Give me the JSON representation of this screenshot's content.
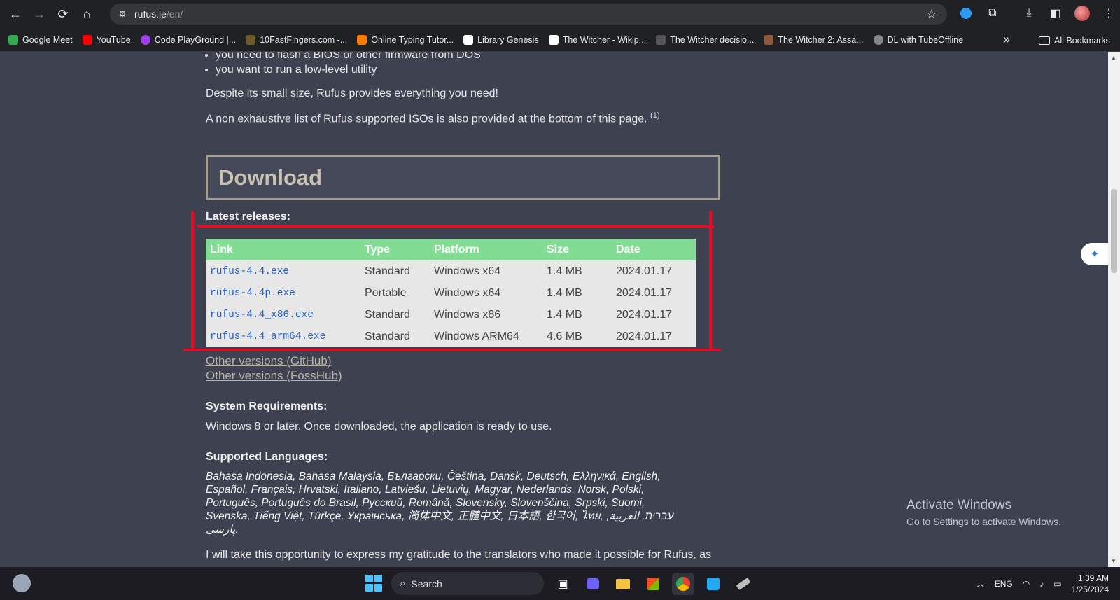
{
  "browser": {
    "url_domain": "rufus.ie",
    "url_path": "/en/",
    "bookmarks": [
      {
        "label": "Google Meet",
        "color": "#34a853"
      },
      {
        "label": "YouTube",
        "color": "#ff0000"
      },
      {
        "label": "Code PlayGround |...",
        "color": "#a142f4"
      },
      {
        "label": "10FastFingers.com -...",
        "color": "#333333"
      },
      {
        "label": "Online Typing Tutor...",
        "color": "#f57c00"
      },
      {
        "label": "Library Genesis",
        "color": "#ffffff"
      },
      {
        "label": "The Witcher - Wikip...",
        "color": "#ffffff"
      },
      {
        "label": "The Witcher decisio...",
        "color": "#555555"
      },
      {
        "label": "The Witcher 2: Assa...",
        "color": "#8a5a3c"
      },
      {
        "label": "DL with TubeOffline",
        "color": "#888888"
      }
    ],
    "all_bookmarks": "All Bookmarks"
  },
  "page": {
    "bullets": [
      "you need to flash a BIOS or other firmware from DOS",
      "you want to run a low-level utility"
    ],
    "para1": "Despite its small size, Rufus provides everything you need!",
    "para2": "A non exhaustive list of Rufus supported ISOs is also provided at the bottom of this page.",
    "para2_sup": "(1)",
    "download_heading": "Download",
    "latest_releases": "Latest releases:",
    "table": {
      "headers": [
        "Link",
        "Type",
        "Platform",
        "Size",
        "Date"
      ],
      "rows": [
        [
          "rufus-4.4.exe",
          "Standard",
          "Windows x64",
          "1.4 MB",
          "2024.01.17"
        ],
        [
          "rufus-4.4p.exe",
          "Portable",
          "Windows x64",
          "1.4 MB",
          "2024.01.17"
        ],
        [
          "rufus-4.4_x86.exe",
          "Standard",
          "Windows x86",
          "1.4 MB",
          "2024.01.17"
        ],
        [
          "rufus-4.4_arm64.exe",
          "Standard",
          "Windows ARM64",
          "4.6 MB",
          "2024.01.17"
        ]
      ]
    },
    "other_github": "Other versions (GitHub)",
    "other_fosshub": "Other versions (FossHub)",
    "sysreq_heading": "System Requirements:",
    "sysreq_text": "Windows 8 or later. Once downloaded, the application is ready to use.",
    "langs_heading": "Supported Languages:",
    "langs_text": "Bahasa Indonesia, Bahasa Malaysia, Български, Čeština, Dansk, Deutsch, Ελληνικά, English, Español, Français, Hrvatski, Italiano, Latviešu, Lietuvių, Magyar, Nederlands, Norsk, Polski, Português, Português do Brasil, Русский, Română, Slovensky, Slovenščina, Srpski, Suomi, Svenska, Tiếng Việt, Türkçe, Українська, 简体中文, 正體中文, 日本語, 한국어, ไทย, עברית, العربية, پارسی.",
    "cut_text": "I will take this opportunity to express my gratitude to the translators who made it possible for Rufus, as"
  },
  "watermark": {
    "line1": "Activate Windows",
    "line2": "Go to Settings to activate Windows."
  },
  "taskbar": {
    "search_label": "Search",
    "lang": "ENG",
    "time": "1:39 AM",
    "date": "1/25/2024"
  }
}
